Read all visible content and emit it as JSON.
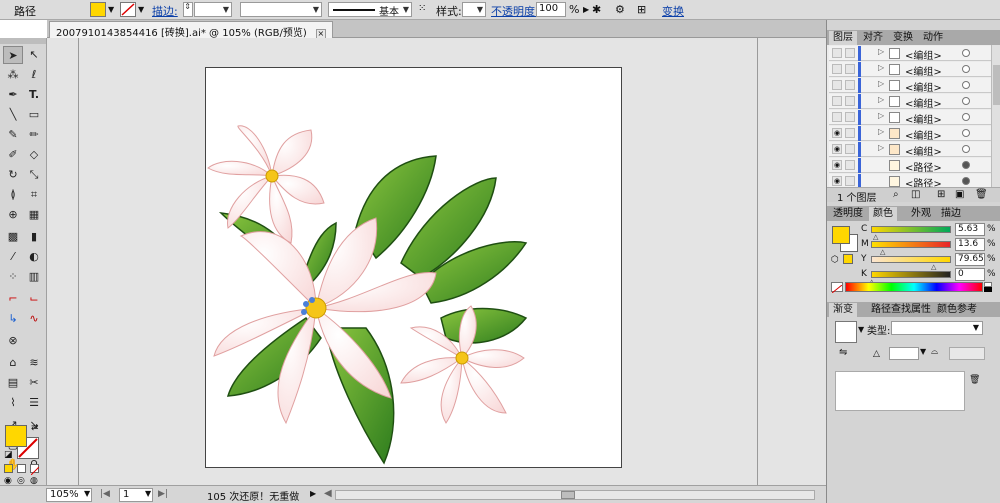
{
  "control_bar": {
    "mode_label": "路径",
    "fill_color": "#ffd700",
    "stroke_label": "描边:",
    "stroke_profile": "基本",
    "style_label": "样式:",
    "opacity_label": "不透明度:",
    "opacity_value": "100",
    "opacity_unit": "%",
    "transform_label": "变换"
  },
  "document_tab": {
    "title": "200791014385441­6 [砖换].ai* @ 105% (RGB/预览)",
    "close_glyph": "×"
  },
  "tools": {
    "text_tool": "T."
  },
  "status_bar": {
    "zoom": "105%",
    "artboard_number": "1",
    "status_text": "105 次还原！无重做"
  },
  "layers_panel": {
    "tabs": [
      "图层",
      "对齐",
      "变换",
      "动作"
    ],
    "rows": [
      {
        "name": "<编组>",
        "visible": false,
        "expandable": true,
        "target_filled": false
      },
      {
        "name": "<编组>",
        "visible": false,
        "expandable": true,
        "target_filled": false
      },
      {
        "name": "<编组>",
        "visible": false,
        "expandable": true,
        "target_filled": false
      },
      {
        "name": "<编组>",
        "visible": false,
        "expandable": true,
        "target_filled": false
      },
      {
        "name": "<编组>",
        "visible": false,
        "expandable": true,
        "target_filled": false
      },
      {
        "name": "<编组>",
        "visible": true,
        "expandable": true,
        "target_filled": false
      },
      {
        "name": "<编组>",
        "visible": true,
        "expandable": true,
        "target_filled": false
      },
      {
        "name": "<路径>",
        "visible": true,
        "expandable": false,
        "target_filled": true
      },
      {
        "name": "<路径>",
        "visible": true,
        "expandable": false,
        "target_filled": true
      }
    ],
    "footer_count": "1 个图层"
  },
  "color_panel": {
    "tabs": [
      "透明度",
      "颜色",
      "外观",
      "描边"
    ],
    "active_tab": "颜色",
    "fill_color": "#ffd700",
    "channels": [
      {
        "label": "C",
        "value": "5.63",
        "unit": "%"
      },
      {
        "label": "M",
        "value": "13.6",
        "unit": "%"
      },
      {
        "label": "Y",
        "value": "79.65",
        "unit": "%"
      },
      {
        "label": "K",
        "value": "0",
        "unit": "%"
      }
    ]
  },
  "gradient_panel": {
    "tabs": [
      "渐变",
      "路径查找",
      "属性",
      "颜色参考"
    ],
    "type_label": "类型:"
  }
}
